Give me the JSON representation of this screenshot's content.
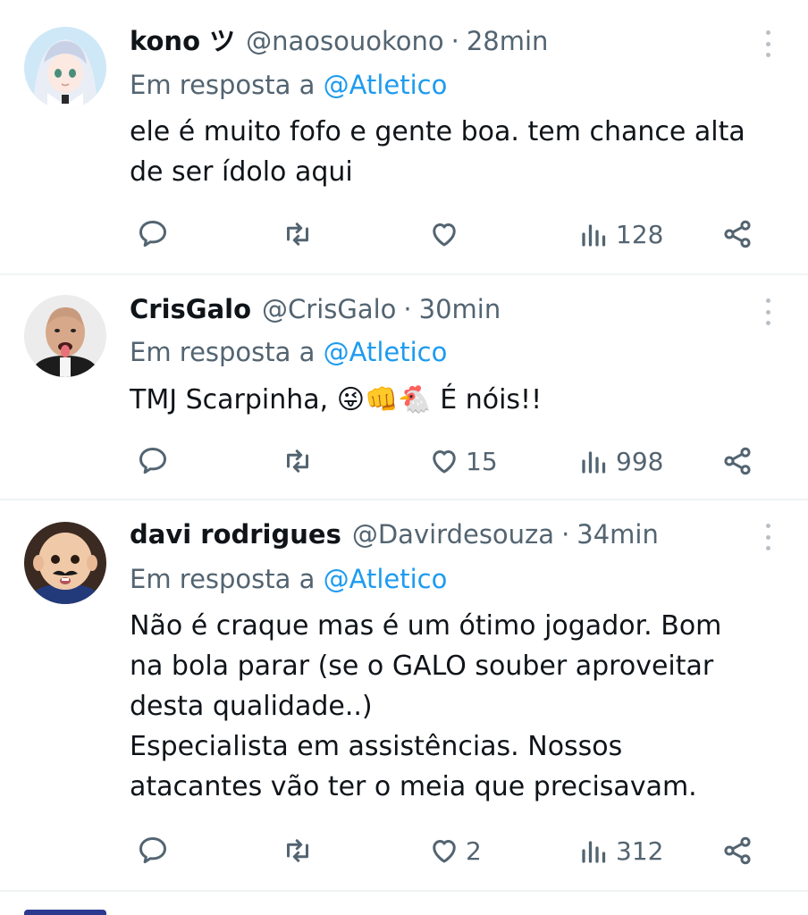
{
  "tweets": [
    {
      "name": "kono ツ",
      "handle": "@naosouokono",
      "separator": "·",
      "time": "28min",
      "reply_prefix": "Em resposta a",
      "reply_to": "@Atletico",
      "lines": [
        "ele é muito fofo e gente boa. tem chance alta",
        "de ser ídolo aqui"
      ],
      "likes": "",
      "views": "128",
      "avatar_icon": "anime-avatar"
    },
    {
      "name": "CrisGalo",
      "handle": "@CrisGalo",
      "separator": "·",
      "time": "30min",
      "reply_prefix": "Em resposta a",
      "reply_to": "@Atletico",
      "lines": [
        "TMJ Scarpinha, 😜👊🐔  É nóis!!"
      ],
      "likes": "15",
      "views": "998",
      "avatar_icon": "bald-man-avatar"
    },
    {
      "name": "davi rodrigues",
      "handle": "@Davirdesouza",
      "separator": "·",
      "time": "34min",
      "reply_prefix": "Em resposta a",
      "reply_to": "@Atletico",
      "lines": [
        "Não é craque mas é um ótimo jogador.  Bom",
        "na bola parar (se o GALO souber aproveitar",
        "desta qualidade..)",
        "Especialista em assistências.  Nossos",
        "atacantes vão ter o meia que precisavam."
      ],
      "likes": "2",
      "views": "312",
      "avatar_icon": "baby-mustache-avatar"
    }
  ],
  "icons": {
    "reply": "reply-icon",
    "retweet": "retweet-icon",
    "like": "heart-icon",
    "views": "views-icon",
    "share": "share-icon",
    "more": "more-vertical-icon"
  },
  "colors": {
    "text": "#0f1419",
    "secondary": "#536471",
    "mention": "#1d9bf0",
    "divider": "#eff3f4"
  }
}
